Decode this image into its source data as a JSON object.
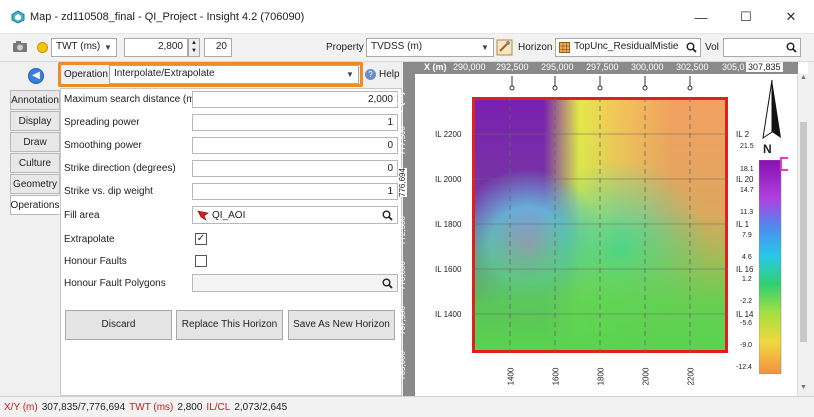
{
  "window": {
    "title": "Map - zd110508_final - QI_Project - Insight 4.2 (706090)",
    "controls": {
      "minimize": "—",
      "maximize": "☐",
      "close": "✕"
    }
  },
  "toolbar": {
    "domain_value": "TWT (ms)",
    "time_value": "2,800",
    "step_value": "20",
    "property_label": "Property",
    "property_value": "TVDSS (m)",
    "horizon_label": "Horizon",
    "horizon_value": "TopUnc_ResidualMistie",
    "vol_label": "Vol",
    "vol_value": ""
  },
  "side_tabs": [
    "Annotation",
    "Display",
    "Draw",
    "Culture",
    "Geometry",
    "Operations"
  ],
  "active_tab": "Operations",
  "operation": {
    "label": "Operation",
    "value": "Interpolate/Extrapolate",
    "help": "Help"
  },
  "params": [
    {
      "label": "Maximum search distance (m)",
      "value": "2,000"
    },
    {
      "label": "Spreading power",
      "value": "1"
    },
    {
      "label": "Smoothing power",
      "value": "0"
    },
    {
      "label": "Strike direction (degrees)",
      "value": "0"
    },
    {
      "label": "Strike vs. dip weight",
      "value": "1"
    }
  ],
  "fill_area": {
    "label": "Fill area",
    "value": "QI_AOI"
  },
  "extrapolate": {
    "label": "Extrapolate",
    "checked": "✓"
  },
  "honour_faults": {
    "label": "Honour Faults"
  },
  "honour_fault_polygons": {
    "label": "Honour Fault Polygons",
    "value": ""
  },
  "buttons": {
    "discard": "Discard",
    "replace": "Replace This Horizon",
    "save_as": "Save As New Horizon"
  },
  "map": {
    "x_axis_label": "X (m)",
    "x_ticks": [
      "290,000",
      "292,500",
      "295,000",
      "297,500",
      "300,000",
      "302,500",
      "305,0",
      "307,835"
    ],
    "y_axis_label": "Y (m)",
    "y_ticks": [
      "777,500",
      "776,694",
      "772,500",
      "770,000",
      "767,500",
      "765,000",
      "7"
    ],
    "il_labels": [
      "IL 2200",
      "IL 2000",
      "IL 1800",
      "IL 1600",
      "IL 1400"
    ],
    "xl_labels": [
      "1400",
      "1600",
      "1800",
      "2000",
      "2200"
    ],
    "right_il_labels": [
      "IL 2",
      "IL 20",
      "IL 1",
      "IL 16",
      "IL 14"
    ],
    "colorbar_ticks": [
      "21.5",
      "18.1",
      "14.7",
      "11.3",
      "7.9",
      "4.6",
      "1.2",
      "-2.2",
      "-5.6",
      "-9.0",
      "-12.4"
    ],
    "north_label": "N",
    "colors": {
      "frame": "#e0201c",
      "purple": "#7a1fb0",
      "green": "#58d450",
      "orange": "#f4a060"
    }
  },
  "status": {
    "xy_label": "X/Y (m)",
    "xy_value": "307,835/7,776,694",
    "twt_label": "TWT (ms)",
    "twt_value": "2,800",
    "ilcl_label": "IL/CL",
    "ilcl_value": "2,073/2,645"
  }
}
